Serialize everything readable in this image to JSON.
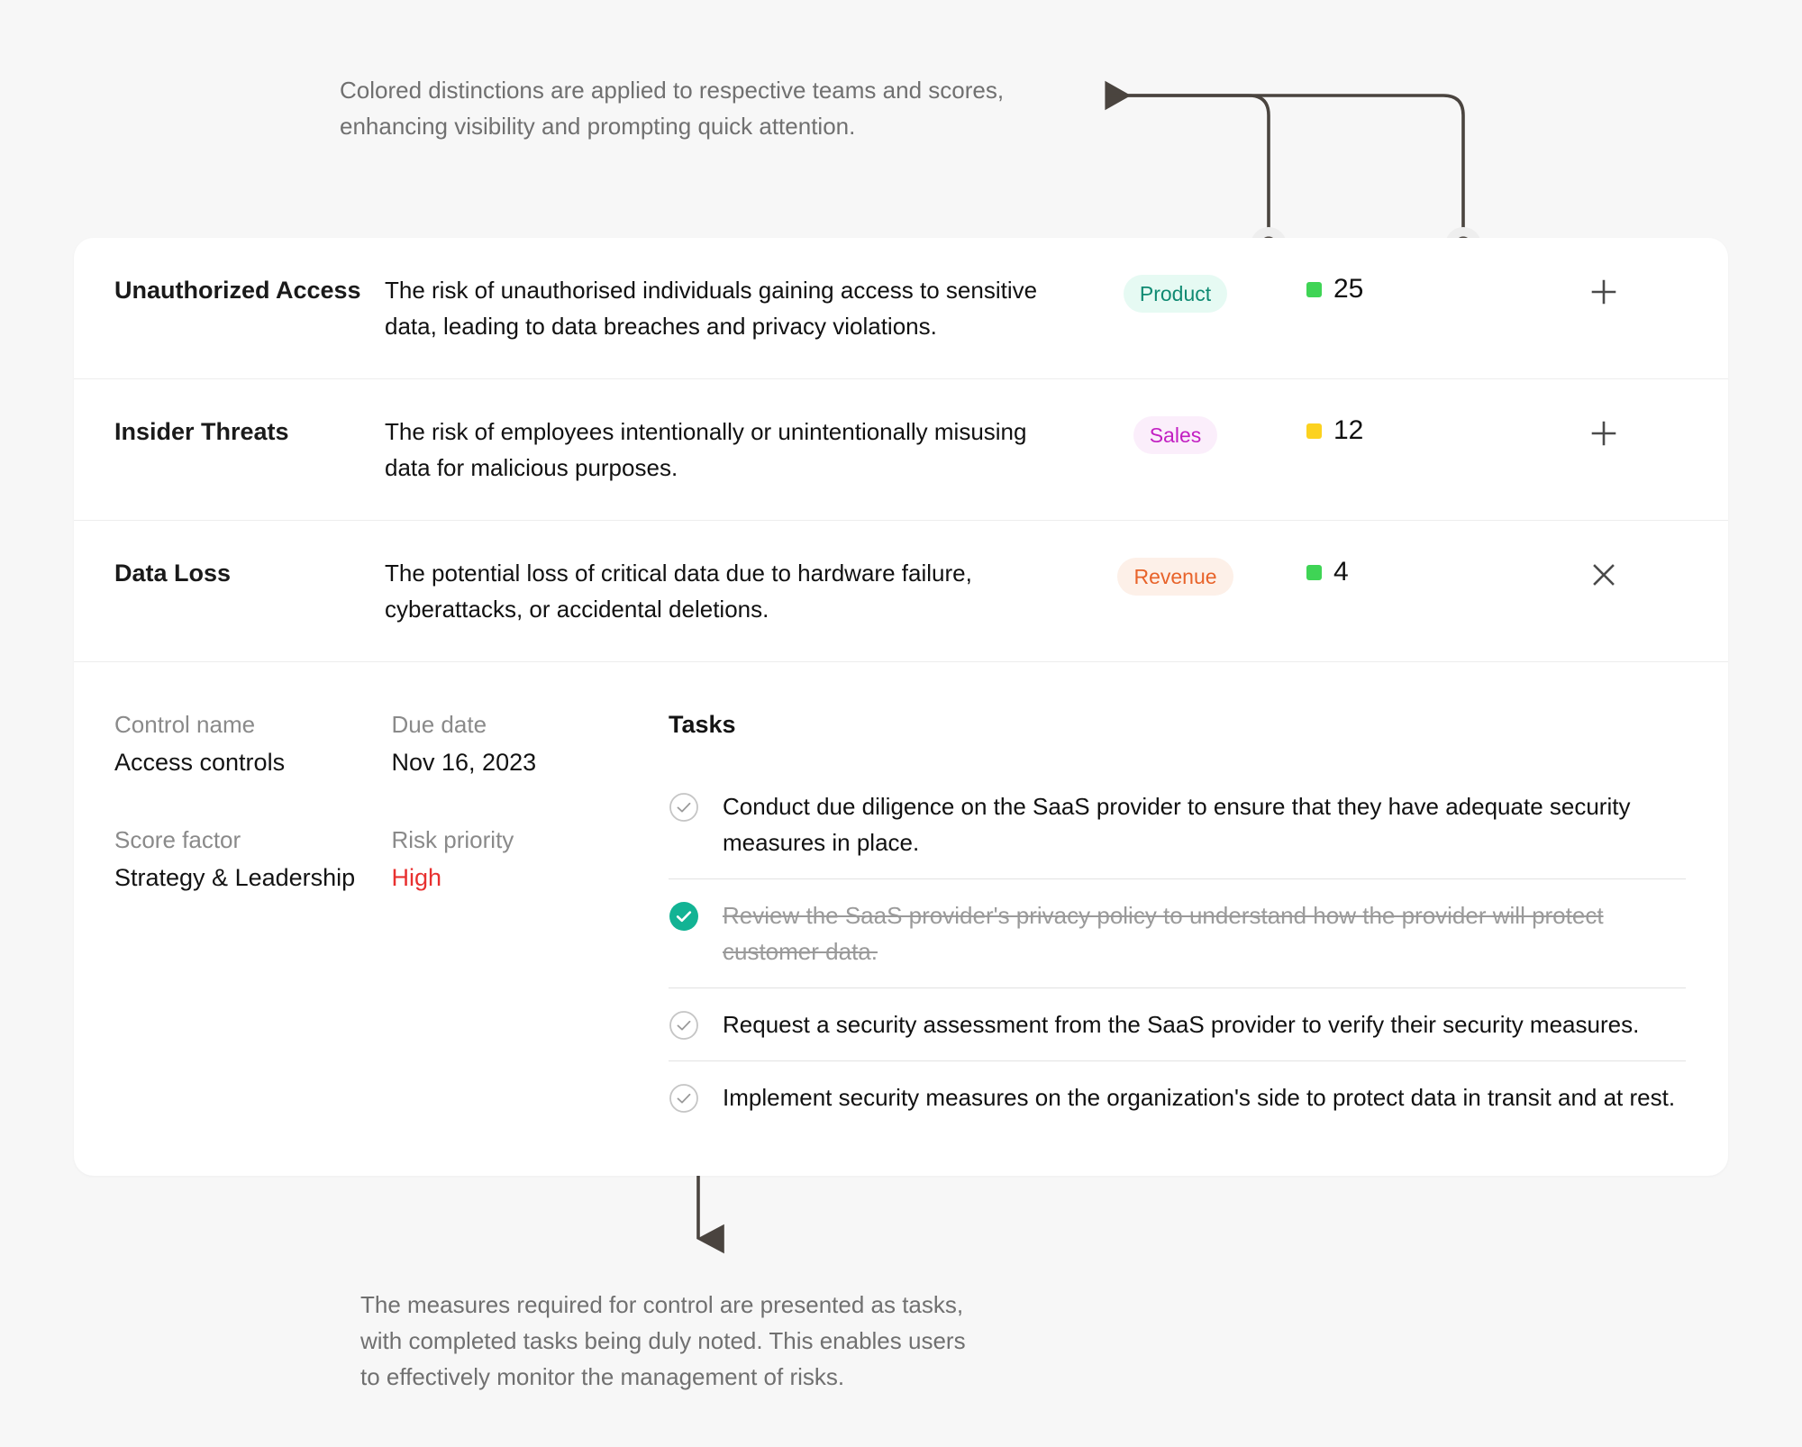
{
  "annotations": {
    "top_note": "Colored distinctions are applied to respective teams and scores,\nenhancing visibility and prompting quick attention.",
    "bottom_note": "The measures required for control are presented as tasks,\nwith completed tasks being duly noted. This enables users\nto effectively monitor the management of risks."
  },
  "colors": {
    "score_green": "#3fd455",
    "score_yellow": "#fcd21f",
    "check_done": "#12b394",
    "risk_high": "#e8302f",
    "badge_product_bg": "#e6faf3",
    "badge_product_fg": "#0f8a72",
    "badge_sales_bg": "#fbeefb",
    "badge_sales_fg": "#c21fc2",
    "badge_revenue_bg": "#fdf0e8",
    "badge_revenue_fg": "#e8632a"
  },
  "risks": [
    {
      "title": "Unauthorized Access",
      "description": "The risk of unauthorised individuals gaining access to sensitive data, leading to data breaches and privacy violations.",
      "team": "Product",
      "team_variant": "product",
      "score": "25",
      "score_color": "green",
      "action": "plus",
      "action_label": "Expand row"
    },
    {
      "title": "Insider Threats",
      "description": "The risk of employees intentionally or unintentionally misusing data for malicious purposes.",
      "team": "Sales",
      "team_variant": "sales",
      "score": "12",
      "score_color": "yellow",
      "action": "plus",
      "action_label": "Expand row"
    },
    {
      "title": "Data Loss",
      "description": "The potential loss of critical data due to hardware failure, cyberattacks, or accidental deletions.",
      "team": "Revenue",
      "team_variant": "revenue",
      "score": "4",
      "score_color": "green",
      "action": "close",
      "action_label": "Collapse row"
    }
  ],
  "detail": {
    "fields": [
      {
        "label": "Control name",
        "value": "Access controls",
        "danger": false
      },
      {
        "label": "Due date",
        "value": "Nov 16, 2023",
        "danger": false
      },
      {
        "label": "Score factor",
        "value": "Strategy & Leadership",
        "danger": false
      },
      {
        "label": "Risk priority",
        "value": "High",
        "danger": true
      }
    ],
    "tasks_title": "Tasks",
    "tasks": [
      {
        "text": "Conduct due diligence on the SaaS provider to ensure that they have adequate security measures in place.",
        "done": false
      },
      {
        "text": "Review the SaaS provider's privacy policy to understand how the provider will protect customer data.",
        "done": true
      },
      {
        "text": "Request a security assessment from the SaaS provider to verify their security measures.",
        "done": false
      },
      {
        "text": "Implement security measures on the organization's side to protect data in transit and at rest.",
        "done": false
      }
    ]
  }
}
